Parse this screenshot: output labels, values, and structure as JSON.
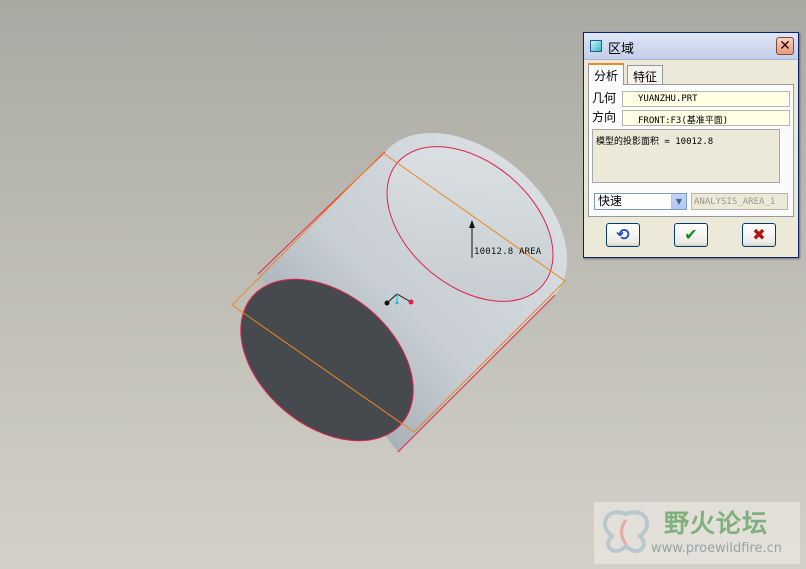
{
  "viewport": {
    "dimension_label": "10012.8 AREA"
  },
  "dialog": {
    "title": "区域",
    "tabs": [
      {
        "label": "分析",
        "active": true
      },
      {
        "label": "特征",
        "active": false
      }
    ],
    "geometry_label": "几何",
    "geometry_value": "YUANZHU.PRT",
    "direction_label": "方向",
    "direction_value": "FRONT:F3(基准平面)",
    "result_text": "模型的投影面积 = 10012.8",
    "mode_value": "快速",
    "analysis_name": "ANALYSIS_AREA_1",
    "buttons": {
      "recompute_icon": "recompute-icon",
      "ok_icon": "checkmark-icon",
      "cancel_icon": "close-icon"
    }
  },
  "watermark": {
    "title": "野火论坛",
    "url": "www.proewildfire.cn"
  },
  "colors": {
    "edge": "#e0234b",
    "projection": "#e88a1c",
    "body": "#b9c0c6",
    "end_face": "#474b4f",
    "dialog_bg": "#ece9d8"
  }
}
